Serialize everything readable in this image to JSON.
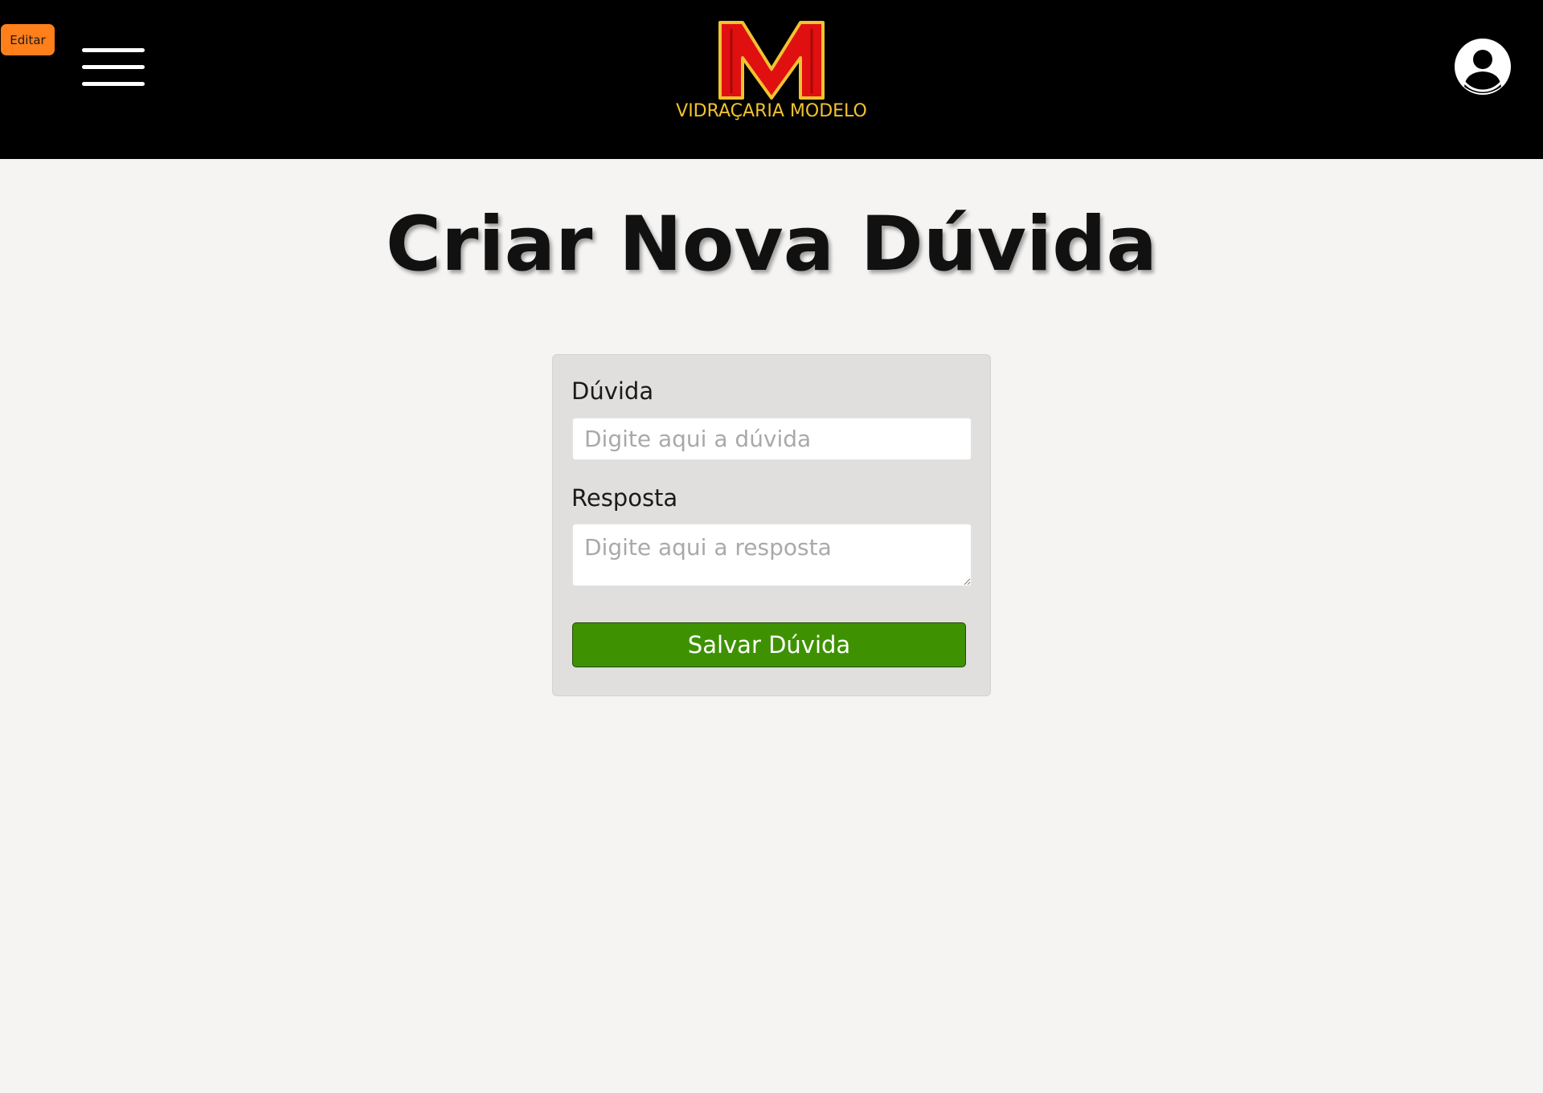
{
  "header": {
    "edit_label": "Editar",
    "menu_icon": "hamburger-menu-icon",
    "logo": {
      "mark": "M",
      "text": "VIDRAÇARIA MODELO",
      "mark_color": "#e01010",
      "outline_color": "#f2c230"
    },
    "profile_icon": "user-avatar-icon"
  },
  "main": {
    "title": "Criar Nova Dúvida",
    "form": {
      "duvida_label": "Dúvida",
      "duvida_placeholder": "Digite aqui a dúvida",
      "duvida_value": "",
      "resposta_label": "Resposta",
      "resposta_placeholder": "Digite aqui a resposta",
      "resposta_value": "",
      "save_label": "Salvar Dúvida"
    }
  },
  "colors": {
    "header_bg": "#000000",
    "page_bg": "#f5f4f2",
    "card_bg": "#e0dfdd",
    "save_button": "#3e9201",
    "edit_button": "#ff7f1a",
    "logo_gold": "#f2c230",
    "logo_red": "#e01010"
  }
}
